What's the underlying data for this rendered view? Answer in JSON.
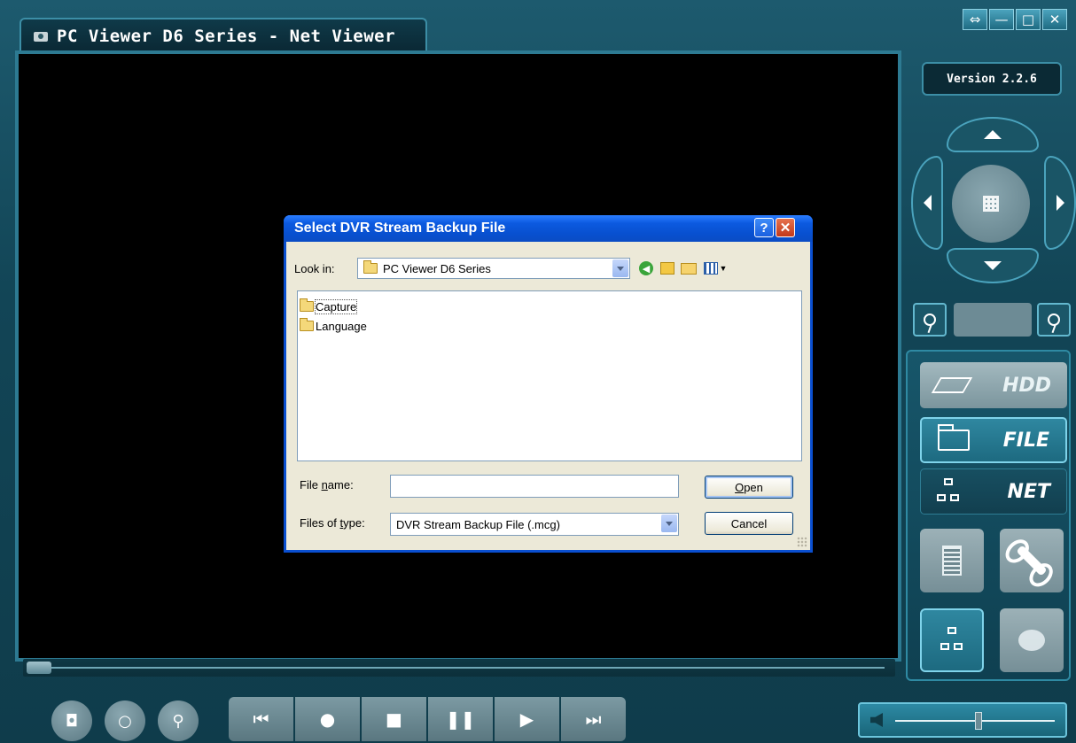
{
  "app": {
    "title": "PC Viewer D6 Series - Net Viewer",
    "version": "Version 2.2.6",
    "window_buttons": [
      "pin",
      "minimize",
      "maximize",
      "close"
    ],
    "colors": {
      "frame": "#2d7a92",
      "panel": "#124556",
      "accent": "#7fd3ea"
    }
  },
  "nav": {
    "hdd": "HDD",
    "file": "FILE",
    "net": "NET"
  },
  "dialog": {
    "title": "Select DVR Stream Backup File",
    "help": "?",
    "close": "✕",
    "look_in_label": "Look in:",
    "look_in_value": "PC Viewer D6 Series",
    "items": [
      {
        "name": "Capture",
        "icon": "folder-icon"
      },
      {
        "name": "Language",
        "icon": "folder-icon"
      }
    ],
    "file_name_label": "File name:",
    "file_name_value": "",
    "files_of_type_label": "Files of type:",
    "files_of_type_value": "DVR Stream Backup File (.mcg)",
    "open_label": "Open",
    "cancel_label": "Cancel"
  }
}
